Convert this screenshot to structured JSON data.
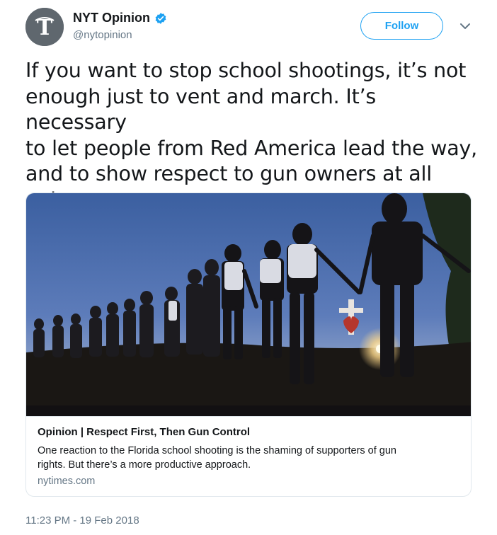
{
  "author": {
    "name": "NYT Opinion",
    "handle": "@nytopinion",
    "avatar_icon": "nyt-logo-icon",
    "verified_icon": "verified-badge-icon"
  },
  "actions": {
    "follow_label": "Follow",
    "menu_icon": "chevron-down-icon"
  },
  "tweet": {
    "line1": "If you want to stop school shootings, it’s not",
    "line2": "enough just to vent and march. It’s necessary",
    "line3": "to let people from Red America lead the way,",
    "line4": "and to show respect to gun owners at all",
    "line5": "points"
  },
  "card": {
    "image_alt": "Students holding hands in a line at sunset near a memorial cross",
    "title": "Opinion | Respect First, Then Gun Control",
    "description_line1": "One reaction to the Florida school shooting is the shaming of supporters of gun",
    "description_line2": "rights. But there’s a more productive approach.",
    "domain": "nytimes.com"
  },
  "timestamp": "11:23 PM - 19 Feb 2018",
  "colors": {
    "accent": "#1da1f2",
    "secondary_text": "#657786",
    "border": "#e1e8ed"
  }
}
